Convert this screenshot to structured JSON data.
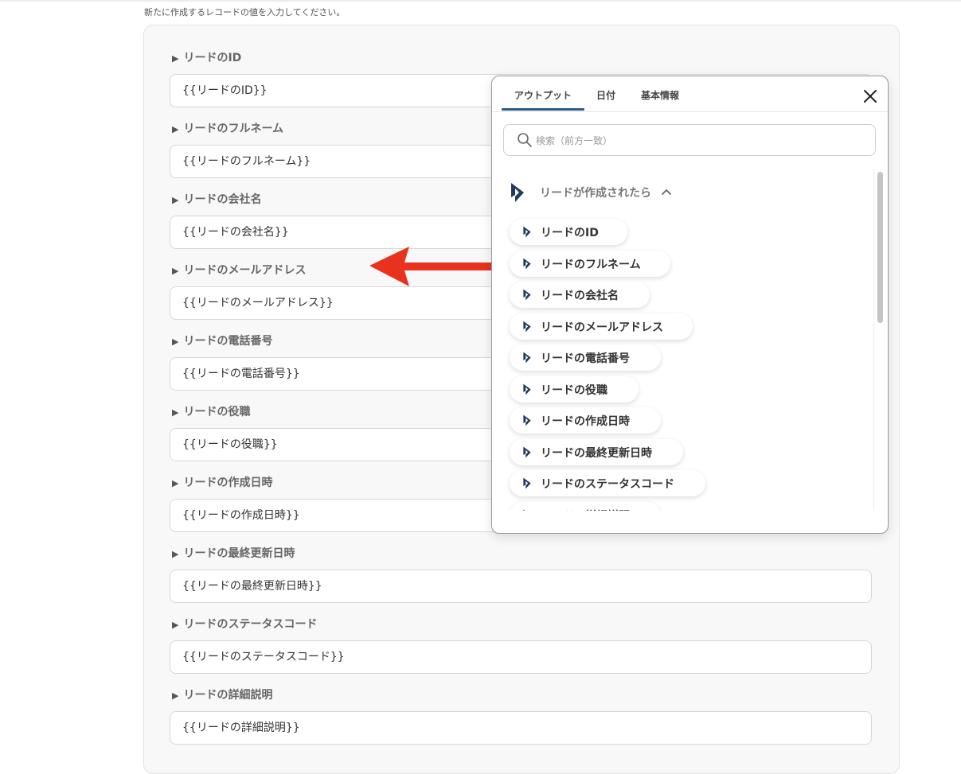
{
  "intro_text": "新たに作成するレコードの値を入力してください。",
  "fields": [
    {
      "label": "リードのID",
      "value": "{{リードのID}}"
    },
    {
      "label": "リードのフルネーム",
      "value": "{{リードのフルネーム}}"
    },
    {
      "label": "リードの会社名",
      "value": "{{リードの会社名}}"
    },
    {
      "label": "リードのメールアドレス",
      "value": "{{リードのメールアドレス}}"
    },
    {
      "label": "リードの電話番号",
      "value": "{{リードの電話番号}}"
    },
    {
      "label": "リードの役職",
      "value": "{{リードの役職}}"
    },
    {
      "label": "リードの作成日時",
      "value": "{{リードの作成日時}}"
    },
    {
      "label": "リードの最終更新日時",
      "value": "{{リードの最終更新日時}}"
    },
    {
      "label": "リードのステータスコード",
      "value": "{{リードのステータスコード}}"
    },
    {
      "label": "リードの詳細説明",
      "value": "{{リードの詳細説明}}"
    }
  ],
  "popover": {
    "tabs": [
      "アウトプット",
      "日付",
      "基本情報"
    ],
    "active_tab": "アウトプット",
    "search_placeholder": "検索（前方一致）",
    "group_label": "リードが作成されたら",
    "group_icon": "dynamics-logo-icon",
    "items": [
      "リードのID",
      "リードのフルネーム",
      "リードの会社名",
      "リードのメールアドレス",
      "リードの電話番号",
      "リードの役職",
      "リードの作成日時",
      "リードの最終更新日時",
      "リードのステータスコード",
      "リードの詳細説明"
    ]
  },
  "colors": {
    "accent_tab": "#2d5b8a",
    "arrow": "#e8321e",
    "logo": "#1f3a5c"
  }
}
